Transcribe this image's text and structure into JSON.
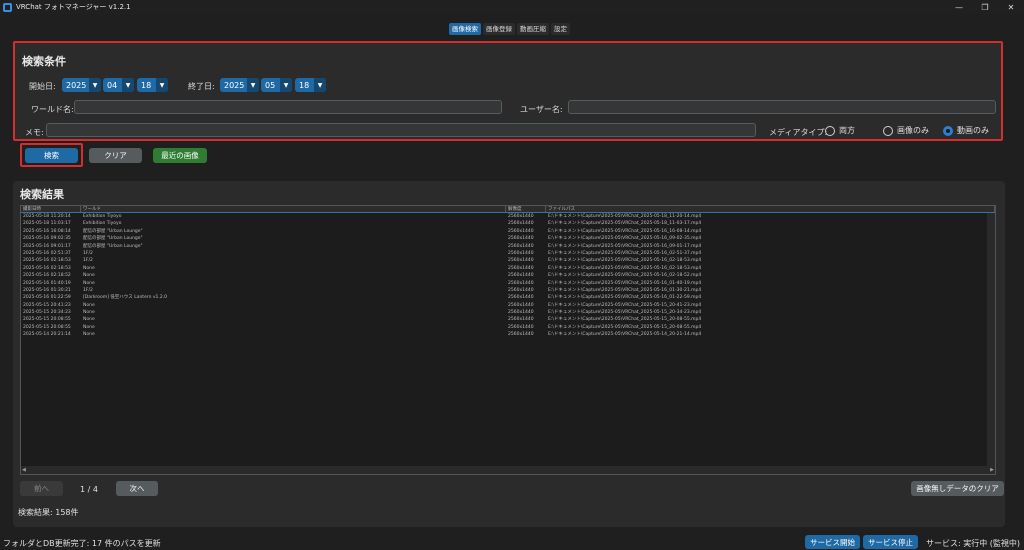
{
  "window": {
    "title": "VRChat フォトマネージャー v1.2.1",
    "min": "—",
    "max": "❐",
    "close": "✕"
  },
  "tabs": [
    "画像検索",
    "画像登録",
    "動画圧縮",
    "設定"
  ],
  "conditions": {
    "title": "検索条件",
    "start_label": "開始日:",
    "start": {
      "year": "2025",
      "month": "04",
      "day": "18"
    },
    "end_label": "終了日:",
    "end": {
      "year": "2025",
      "month": "05",
      "day": "18"
    },
    "world_label": "ワールド名:",
    "world_value": "",
    "user_label": "ユーザー名:",
    "user_value": "",
    "memo_label": "メモ:",
    "memo_value": "",
    "media_label": "メディアタイプ:",
    "media_options": [
      "両方",
      "画像のみ",
      "動画のみ"
    ],
    "media_selected": "動画のみ"
  },
  "buttons": {
    "search": "検索",
    "clear": "クリア",
    "recent": "最近の画像"
  },
  "results": {
    "title": "検索結果",
    "columns": [
      "撮影日時",
      "ワールド",
      "解像度",
      "ファイルパス"
    ],
    "rows": [
      [
        "2025-05-18 11:20:14",
        "Exhibition Tiyoyo",
        "2560x1440",
        "E:\\ドキュメント\\Capture\\2025-05\\VRChat_2025-05-18_11-20-14.mp4"
      ],
      [
        "2025-05-18 11:03:17",
        "Exhibition Tiyoyo",
        "2560x1440",
        "E:\\ドキュメント\\Capture\\2025-05\\VRChat_2025-05-18_11-03-17.mp4"
      ],
      [
        "2025-05-16 16:08:14",
        "配信の部屋 \"Urban Lounge\"",
        "2560x1440",
        "E:\\ドキュメント\\Capture\\2025-05\\VRChat_2025-05-16_16-08-14.mp4"
      ],
      [
        "2025-05-16 09:02:35",
        "配信の部屋 \"Urban Lounge\"",
        "2560x1440",
        "E:\\ドキュメント\\Capture\\2025-05\\VRChat_2025-05-16_09-02-35.mp4"
      ],
      [
        "2025-05-16 09:01:17",
        "配信の部屋 \"Urban Lounge\"",
        "2560x1440",
        "E:\\ドキュメント\\Capture\\2025-05\\VRChat_2025-05-16_09-01-17.mp4"
      ],
      [
        "2025-05-16 02:51:37",
        "1F/2",
        "2560x1440",
        "E:\\ドキュメント\\Capture\\2025-05\\VRChat_2025-05-16_02-51-37.mp4"
      ],
      [
        "2025-05-16 02:18:53",
        "1F/2",
        "2560x1440",
        "E:\\ドキュメント\\Capture\\2025-05\\VRChat_2025-05-16_02-18-53.mp4"
      ],
      [
        "2025-05-16 02:18:53",
        "None",
        "2560x1440",
        "E:\\ドキュメント\\Capture\\2025-05\\VRChat_2025-05-16_02-18-53.mp4"
      ],
      [
        "2025-05-16 02:18:52",
        "None",
        "2560x1440",
        "E:\\ドキュメント\\Capture\\2025-05\\VRChat_2025-05-16_02-18-52.mp4"
      ],
      [
        "2025-05-16 01:40:19",
        "None",
        "2560x1440",
        "E:\\ドキュメント\\Capture\\2025-05\\VRChat_2025-05-16_01-40-19.mp4"
      ],
      [
        "2025-05-16 01:30:21",
        "1F/2",
        "2560x1440",
        "E:\\ドキュメント\\Capture\\2025-05\\VRChat_2025-05-16_01-30-21.mp4"
      ],
      [
        "2025-05-16 01:22:59",
        "[Darkroom] 低空ハウス Lantern v1.2.0",
        "2560x1440",
        "E:\\ドキュメント\\Capture\\2025-05\\VRChat_2025-05-16_01-22-59.mp4"
      ],
      [
        "2025-05-15 20:41:23",
        "None",
        "2560x1440",
        "E:\\ドキュメント\\Capture\\2025-05\\VRChat_2025-05-15_20-41-23.mp4"
      ],
      [
        "2025-05-15 20:34:23",
        "None",
        "2560x1440",
        "E:\\ドキュメント\\Capture\\2025-05\\VRChat_2025-05-15_20-34-23.mp4"
      ],
      [
        "2025-05-15 20:08:55",
        "None",
        "2560x1440",
        "E:\\ドキュメント\\Capture\\2025-05\\VRChat_2025-05-15_20-08-55.mp4"
      ],
      [
        "2025-05-15 20:08:55",
        "None",
        "2560x1440",
        "E:\\ドキュメント\\Capture\\2025-05\\VRChat_2025-05-15_20-08-55.mp4"
      ],
      [
        "2025-05-14 20:21:14",
        "None",
        "2560x1440",
        "E:\\ドキュメント\\Capture\\2025-05\\VRChat_2025-05-14_20-21-14.mp4"
      ]
    ],
    "prev": "前へ",
    "page": "1 / 4",
    "next": "次へ",
    "clear_nodata": "画像無しデータのクリア",
    "count": "検索結果: 158件"
  },
  "status": {
    "message": "フォルダとDB更新完了: 17 件のパスを更新",
    "start_service": "サービス開始",
    "stop_service": "サービス停止",
    "service_state": "サービス: 実行中 (監視中)"
  },
  "colors": {
    "accent": "#1f6aa5",
    "highlight": "#d32f2f",
    "green": "#2e7d32"
  }
}
